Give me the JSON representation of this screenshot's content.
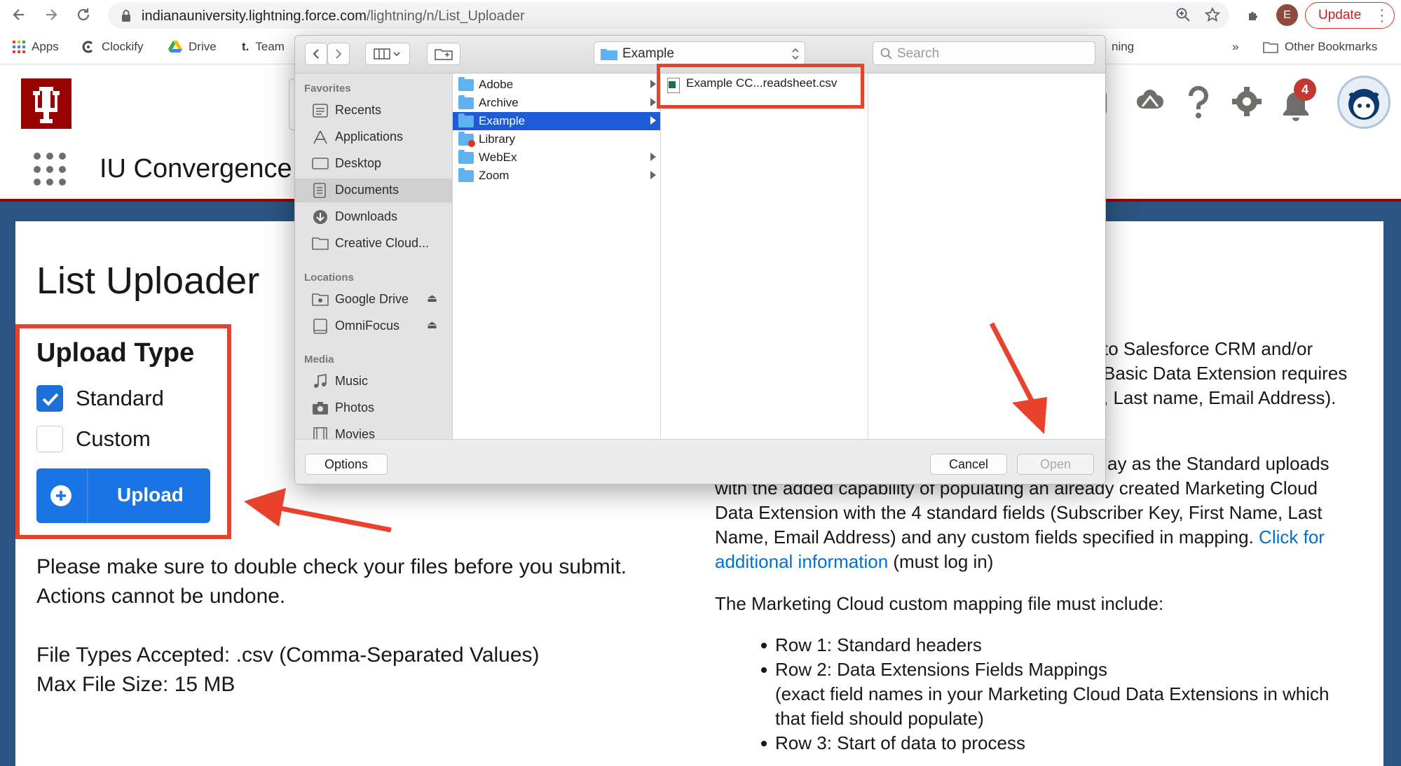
{
  "browser": {
    "url_host": "indianauniversity.lightning.force.com",
    "url_path": "/lightning/n/List_Uploader",
    "profile_initial": "E",
    "update_label": "Update"
  },
  "bookmarks": {
    "items": [
      "Apps",
      "Clockify",
      "Drive",
      "Team"
    ],
    "partial_right": "ning",
    "more": "»",
    "other": "Other Bookmarks"
  },
  "app": {
    "name": "IU Convergence",
    "notification_count": "4"
  },
  "page": {
    "title": "List Uploader",
    "upload_type_heading": "Upload Type",
    "options": [
      {
        "label": "Standard",
        "checked": true
      },
      {
        "label": "Custom",
        "checked": false
      }
    ],
    "upload_button": "Upload",
    "warning_line1": "Please make sure to double check your files before you submit.",
    "warning_line2": "Actions cannot be undone.",
    "file_types": "File Types Accepted: .csv (Comma-Separated Values)",
    "max_size": "Max File Size: 15 MB"
  },
  "right_panel": {
    "p1_line1": "to Salesforce CRM and/or",
    "p1_line2": "Basic Data Extension requires",
    "p1_line3": ", Last name, Email Address).",
    "p2_line1": "ay as the Standard uploads",
    "p2_line2": "with the added capability of populating an already created Marketing Cloud",
    "p2_line3": "Data Extension with the 4 standard fields (Subscriber Key, First Name, Last",
    "p2_line4_a": "Name, Email Address) and any custom fields specified in mapping. ",
    "p2_link_a": "Click for",
    "p2_link_b": "additional information",
    "p2_line5_b": " (must log in)",
    "mapping_intro": "The Marketing Cloud custom mapping file must include:",
    "rows": [
      "Row 1: Standard headers",
      "Row 2: Data Extensions Fields Mappings",
      "(exact field names in your Marketing Cloud Data Extensions in which",
      "that field should populate)",
      "Row 3: Start of data to process"
    ]
  },
  "dialog": {
    "current_folder": "Example",
    "search_placeholder": "Search",
    "sidebar": {
      "favorites_label": "Favorites",
      "favorites": [
        "Recents",
        "Applications",
        "Desktop",
        "Documents",
        "Downloads",
        "Creative Cloud..."
      ],
      "selected_favorite": "Documents",
      "locations_label": "Locations",
      "locations": [
        "Google Drive",
        "OmniFocus"
      ],
      "media_label": "Media",
      "media": [
        "Music",
        "Photos",
        "Movies"
      ]
    },
    "folders": [
      {
        "name": "Adobe",
        "selected": false
      },
      {
        "name": "Archive",
        "selected": false
      },
      {
        "name": "Example",
        "selected": true
      },
      {
        "name": "Library",
        "selected": false
      },
      {
        "name": "WebEx",
        "selected": false
      },
      {
        "name": "Zoom",
        "selected": false
      }
    ],
    "file": "Example CC...readsheet.csv",
    "options_button": "Options",
    "cancel_button": "Cancel",
    "open_button": "Open"
  },
  "colors": {
    "annotation_red": "#e8412c",
    "iu_crimson": "#990000",
    "salesforce_blue": "#1b74e4",
    "finder_selection": "#1f5bd6"
  }
}
